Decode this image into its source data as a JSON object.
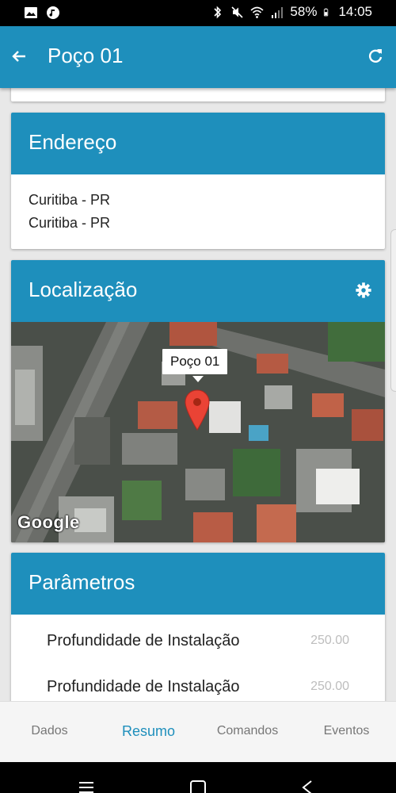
{
  "status_bar": {
    "battery": "58%",
    "time": "14:05",
    "left_icons": [
      "image-icon",
      "music-icon"
    ],
    "right_icons": [
      "bluetooth-icon",
      "mute-icon",
      "wifi-icon",
      "signal-icon",
      "battery-icon"
    ]
  },
  "app_bar": {
    "title": "Poço 01",
    "back_icon": "arrow-back-icon",
    "refresh_icon": "refresh-icon"
  },
  "address": {
    "header": "Endereço",
    "lines": [
      "Curitiba - PR",
      "Curitiba - PR"
    ]
  },
  "location": {
    "header": "Localização",
    "settings_icon": "gear-icon",
    "marker_label": "Poço 01",
    "map_attribution": "Google"
  },
  "parameters": {
    "header": "Parâmetros",
    "rows": [
      {
        "label": "Profundidade de Instalação",
        "value": "250.00"
      },
      {
        "label": "Profundidade de Instalação",
        "value": "250.00"
      }
    ]
  },
  "bottom_nav": {
    "tabs": [
      "Dados",
      "Resumo",
      "Comandos",
      "Eventos"
    ],
    "active": "Resumo"
  },
  "colors": {
    "primary": "#1e8fbc",
    "background": "#e8e8e8",
    "inactive_tab": "#777777"
  }
}
